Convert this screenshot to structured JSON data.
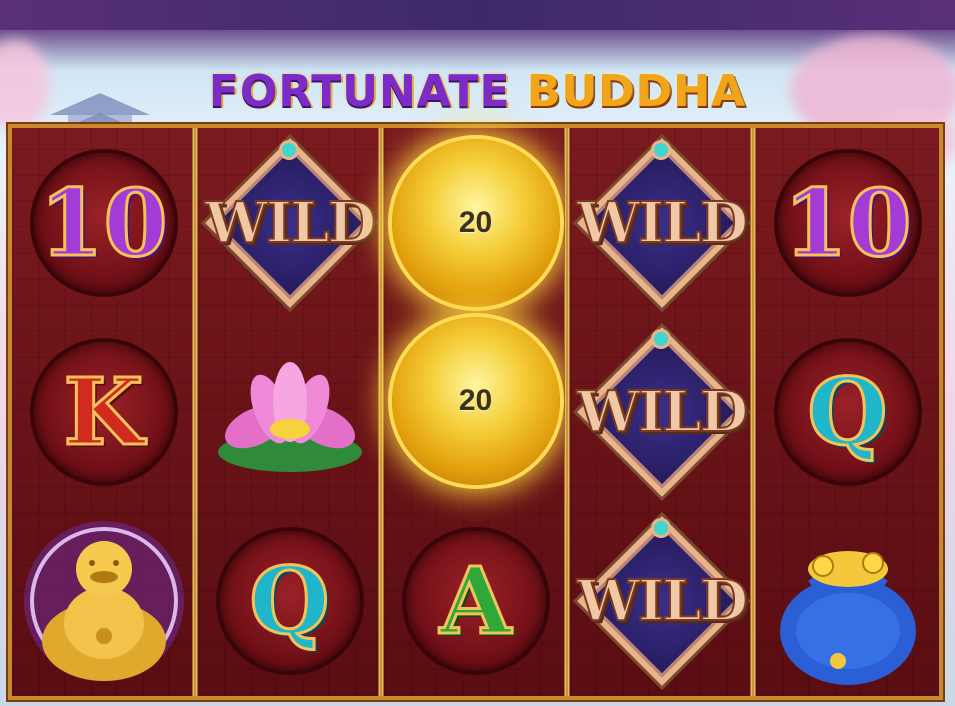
{
  "game": {
    "title_word1": "FORTUNATE",
    "title_word2": "BUDDHA"
  },
  "reels": [
    {
      "symbols": [
        "10",
        "K",
        "buddha"
      ]
    },
    {
      "symbols": [
        "WILD",
        "lotus",
        "Q"
      ]
    },
    {
      "symbols": [
        "coin",
        "coin",
        "A"
      ]
    },
    {
      "symbols": [
        "WILD",
        "WILD",
        "WILD"
      ]
    },
    {
      "symbols": [
        "10",
        "Q",
        "money-bag"
      ]
    }
  ],
  "labels": {
    "ten": "10",
    "king": "K",
    "queen": "Q",
    "ace": "A",
    "wild": "WILD"
  },
  "coins": [
    {
      "value": "20"
    },
    {
      "value": "20"
    }
  ],
  "colors": {
    "frame_gold": "#c98a2e",
    "reel_red": "#5a0c12",
    "coin_gold": "#f5cf3a",
    "wild_diamond": "#2f2472"
  }
}
